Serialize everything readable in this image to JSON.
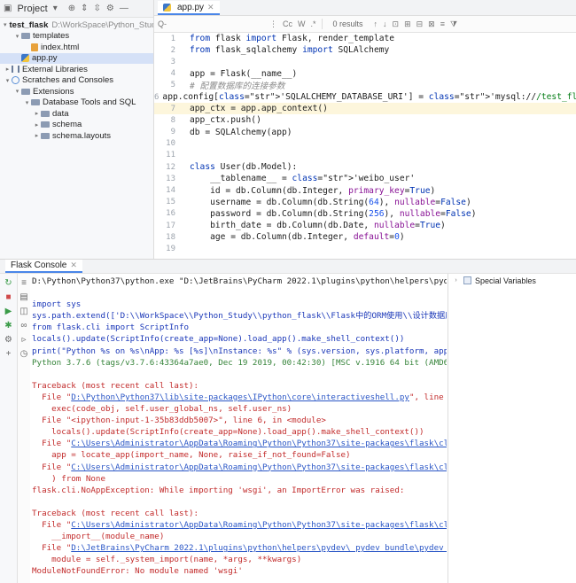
{
  "project_panel": {
    "title": "Project",
    "toolbar_icons": [
      "dropdown-icon",
      "target-icon",
      "expand-all-icon",
      "collapse-all-icon",
      "gear-icon",
      "hide-icon"
    ],
    "tree": [
      {
        "label": "test_flask",
        "suffix": "D:\\WorkSpace\\Python_Study\\py",
        "indent": 0,
        "icon": "folder",
        "chevron": "down",
        "bold": true
      },
      {
        "label": "templates",
        "indent": 1,
        "icon": "folder",
        "chevron": "down"
      },
      {
        "label": "index.html",
        "indent": 2,
        "icon": "html"
      },
      {
        "label": "app.py",
        "indent": 1,
        "icon": "py",
        "selected": true
      },
      {
        "label": "External Libraries",
        "indent": 0,
        "icon": "lib",
        "chevron": "right"
      },
      {
        "label": "Scratches and Consoles",
        "indent": 0,
        "icon": "scratch",
        "chevron": "down"
      },
      {
        "label": "Extensions",
        "indent": 1,
        "icon": "folder",
        "chevron": "down"
      },
      {
        "label": "Database Tools and SQL",
        "indent": 2,
        "icon": "folder",
        "chevron": "down"
      },
      {
        "label": "data",
        "indent": 3,
        "icon": "folder",
        "chevron": "right"
      },
      {
        "label": "schema",
        "indent": 3,
        "icon": "folder",
        "chevron": "right"
      },
      {
        "label": "schema.layouts",
        "indent": 3,
        "icon": "folder",
        "chevron": "right"
      }
    ]
  },
  "editor": {
    "tab_label": "app.py",
    "find": {
      "placeholder": "Q-",
      "results": "0 results",
      "options": [
        "Cc",
        "W",
        ".*"
      ]
    },
    "lines": [
      {
        "n": "1",
        "t": "from flask import Flask, render_template"
      },
      {
        "n": "2",
        "t": "from flask_sqlalchemy import SQLAlchemy"
      },
      {
        "n": "3",
        "t": ""
      },
      {
        "n": "4",
        "t": "app = Flask(__name__)"
      },
      {
        "n": "5",
        "t": "# 配置数据库的连接参数"
      },
      {
        "n": "6",
        "t": "app.config['SQLALCHEMY_DATABASE_URI'] = 'mysql://",
        "tail": "/test_flask'",
        "blur": true
      },
      {
        "n": "7",
        "t": "app_ctx = app.app_context()",
        "hl": true
      },
      {
        "n": "8",
        "t": "app_ctx.push()"
      },
      {
        "n": "9",
        "t": "db = SQLAlchemy(app)"
      },
      {
        "n": "10",
        "t": ""
      },
      {
        "n": "11",
        "t": ""
      },
      {
        "n": "12",
        "t": "class User(db.Model):"
      },
      {
        "n": "13",
        "t": "    __tablename__ = 'weibo_user'"
      },
      {
        "n": "14",
        "t": "    id = db.Column(db.Integer, primary_key=True)"
      },
      {
        "n": "15",
        "t": "    username = db.Column(db.String(64), nullable=False)"
      },
      {
        "n": "16",
        "t": "    password = db.Column(db.String(256), nullable=False)"
      },
      {
        "n": "17",
        "t": "    birth_date = db.Column(db.Date, nullable=True)"
      },
      {
        "n": "18",
        "t": "    age = db.Column(db.Integer, default=0)"
      },
      {
        "n": "19",
        "t": ""
      }
    ]
  },
  "console": {
    "tab_label": "Flask Console",
    "lines": [
      {
        "c": "",
        "t": "D:\\Python\\Python37\\python.exe \"D:\\JetBrains\\PyCharm 2022.1\\plugins\\python\\helpers\\pydev\\pydevconsol"
      },
      {
        "c": "",
        "t": ""
      },
      {
        "c": "blue",
        "t": "import sys"
      },
      {
        "c": "blue",
        "t": "sys.path.extend(['D:\\\\WorkSpace\\\\Python_Study\\\\python_flask\\\\Flask中的ORM使用\\\\设计数据库模型并创建表\\\\"
      },
      {
        "c": "blue",
        "t": "from flask.cli import ScriptInfo"
      },
      {
        "c": "blue",
        "t": "locals().update(ScriptInfo(create_app=None).load_app().make_shell_context())"
      },
      {
        "c": "blue",
        "t": "print(\"Python %s on %s\\nApp: %s [%s]\\nInstance: %s\" % (sys.version, sys.platform, app.import_name,"
      },
      {
        "c": "green",
        "t": "Python 3.7.6 (tags/v3.7.6:43364a7ae0, Dec 19 2019, 00:42:30) [MSC v.1916 64 bit (AMD64)]"
      },
      {
        "c": "",
        "t": ""
      },
      {
        "c": "red",
        "t": "Traceback (most recent call last):"
      },
      {
        "c": "red",
        "t": "  File \"",
        "link": "D:\\Python\\Python37\\lib\\site-packages\\IPython\\core\\interactiveshell.py",
        "tail": "\", line 3553, in run_"
      },
      {
        "c": "red",
        "t": "    exec(code_obj, self.user_global_ns, self.user_ns)"
      },
      {
        "c": "red",
        "t": "  File \"<ipython-input-1-35b83ddb5007>\", line 6, in <module>"
      },
      {
        "c": "red",
        "t": "    locals().update(ScriptInfo(create_app=None).load_app().make_shell_context())"
      },
      {
        "c": "red",
        "t": "  File \"",
        "link": "C:\\Users\\Administrator\\AppData\\Roaming\\Python\\Python37\\site-packages\\flask\\cli.py",
        "tail": "\", line 2"
      },
      {
        "c": "red",
        "t": "    app = locate_app(import_name, None, raise_if_not_found=False)"
      },
      {
        "c": "red",
        "t": "  File \"",
        "link": "C:\\Users\\Administrator\\AppData\\Roaming\\Python\\Python37\\site-packages\\flask\\cli.py",
        "tail": "\", line 2"
      },
      {
        "c": "red",
        "t": "    ) from None"
      },
      {
        "c": "red",
        "t": "flask.cli.NoAppException: While importing 'wsgi', an ImportError was raised:"
      },
      {
        "c": "",
        "t": ""
      },
      {
        "c": "red",
        "t": "Traceback (most recent call last):"
      },
      {
        "c": "red",
        "t": "  File \"",
        "link": "C:\\Users\\Administrator\\AppData\\Roaming\\Python\\Python37\\site-packages\\flask\\cli.py",
        "tail": "\", line 2"
      },
      {
        "c": "red",
        "t": "    __import__(module_name)"
      },
      {
        "c": "red",
        "t": "  File \"",
        "link": "D:\\JetBrains\\PyCharm 2022.1\\plugins\\python\\helpers\\pydev\\_pydev_bundle\\pydev_import_hook.p",
        "tail": ""
      },
      {
        "c": "red",
        "t": "    module = self._system_import(name, *args, **kwargs)"
      },
      {
        "c": "red",
        "t": "ModuleNotFoundError: No module named 'wsgi'"
      }
    ],
    "variables_panel": {
      "label": "Special Variables"
    }
  },
  "colors": {
    "accent": "#4a86e8",
    "error_text": "#c22b2b",
    "input_text": "#1a37b8",
    "version_text": "#36843a"
  }
}
